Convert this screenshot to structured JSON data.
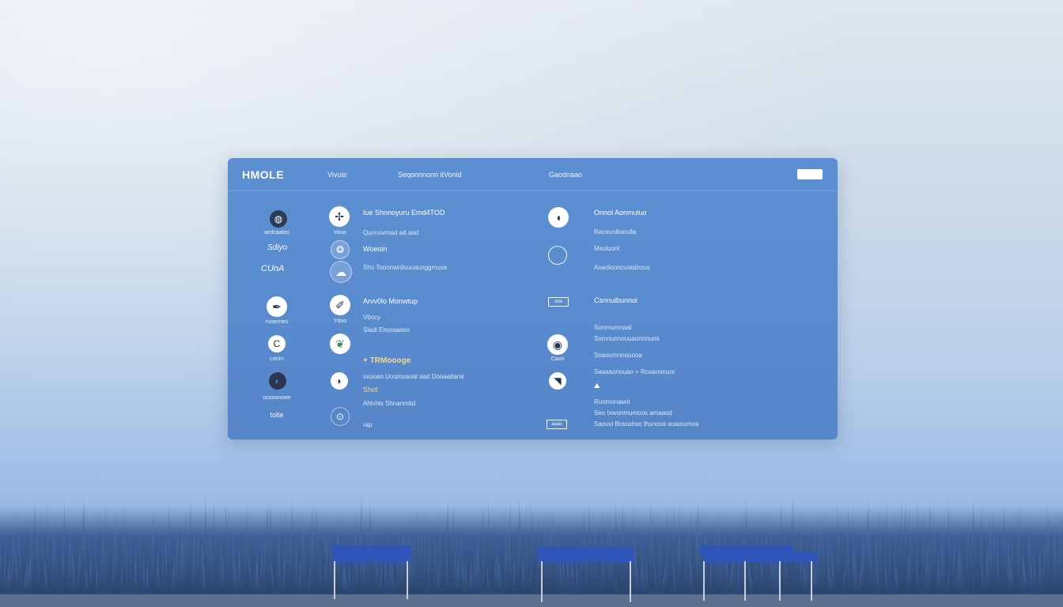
{
  "topbar": {
    "brand": "HMOLE",
    "nav": [
      "Vivusr",
      "Seqonnnonn itVonid",
      "Gaodnaao"
    ],
    "action_button": ""
  },
  "left_icons": [
    {
      "icon": "globe-icon",
      "label": "wrdcaatos"
    },
    {
      "icon": "script-icon",
      "label": "Sdiyo"
    },
    {
      "icon": "swirl-icon",
      "label": "CUnA"
    },
    {
      "icon": "pen-icon",
      "label": "rvoecnes"
    },
    {
      "icon": "c-letter-icon",
      "label": "crtrirn"
    },
    {
      "icon": "moon-icon",
      "label": "ocoosnowe"
    },
    {
      "icon": "sprout-icon",
      "label": "tolte"
    }
  ],
  "mid_items": [
    {
      "icon": "compass-icon",
      "sub": "Vouo",
      "title": "Iue Shnnoyuru Emd4TOD",
      "desc": "Qunnovmad ad aad"
    },
    {
      "icon": "seal-icon",
      "title": "Woeoin"
    },
    {
      "icon": "cloud-icon",
      "title": "Sho Toonnwrdouuaunggmuse"
    },
    {
      "icon": "pen-icon",
      "sub": "Ydoo",
      "title": "Arvv0lo Monwtup",
      "desc": "Vbocy",
      "desc2": "Sladi  Enoraaaso"
    },
    {
      "icon": "leaf-icon",
      "title": "+ TRMoooge",
      "desc": "vvuuao  Uoumuaoal aad Doaaaltane",
      "desc2": "Shot",
      "desc3": "Ahlvhls    Shnanmitd"
    },
    {
      "icon": "circle-icon",
      "title": "rap"
    }
  ],
  "right_items": [
    {
      "icon": "half-circle-icon",
      "title": "Onnol Aonmuiuo",
      "desc": "Raceunlbarulla",
      "desc2": "Msuluonl",
      "desc3": "Aoaoloonoustdoous"
    },
    {
      "chip": "ooo",
      "title": "Csnnulbunnoi",
      "desc": "Sonrnumnaal",
      "desc2": "Somnunnouuaonnnuos",
      "desc3": "Soaoumnnouooa"
    },
    {
      "icon": "eye-icon",
      "label": "Caon",
      "desc": "Saaaaonouao + Rcaaoonuor"
    },
    {
      "icon": "horn-icon",
      "desc": "Ruomonaenl",
      "desc2": "Seo Ixwonmumoos amaasd",
      "desc3": "Saouvi Brasahso thunous auaioumos"
    },
    {
      "chip": "auao"
    }
  ]
}
